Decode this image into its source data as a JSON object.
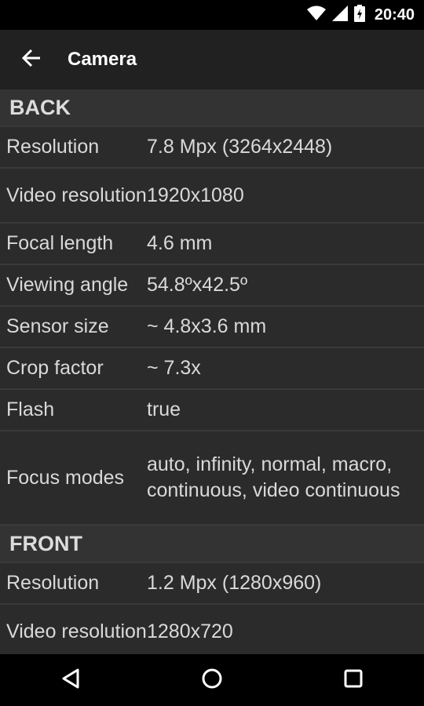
{
  "status": {
    "time": "20:40"
  },
  "appbar": {
    "title": "Camera"
  },
  "sections": [
    {
      "title": "BACK",
      "rows": [
        {
          "label": "Resolution",
          "value": "7.8 Mpx (3264x2448)"
        },
        {
          "label": "Video resolution",
          "value": "1920x1080"
        },
        {
          "label": "Focal length",
          "value": "4.6 mm"
        },
        {
          "label": "Viewing angle",
          "value": "54.8ºx42.5º"
        },
        {
          "label": "Sensor size",
          "value": "~ 4.8x3.6 mm"
        },
        {
          "label": "Crop factor",
          "value": "~ 7.3x"
        },
        {
          "label": "Flash",
          "value": "true"
        },
        {
          "label": "Focus modes",
          "value": "auto, infinity, normal, macro, continuous, video continuous"
        }
      ]
    },
    {
      "title": "FRONT",
      "rows": [
        {
          "label": "Resolution",
          "value": "1.2 Mpx (1280x960)"
        },
        {
          "label": "Video resolution",
          "value": "1280x720"
        }
      ]
    }
  ]
}
